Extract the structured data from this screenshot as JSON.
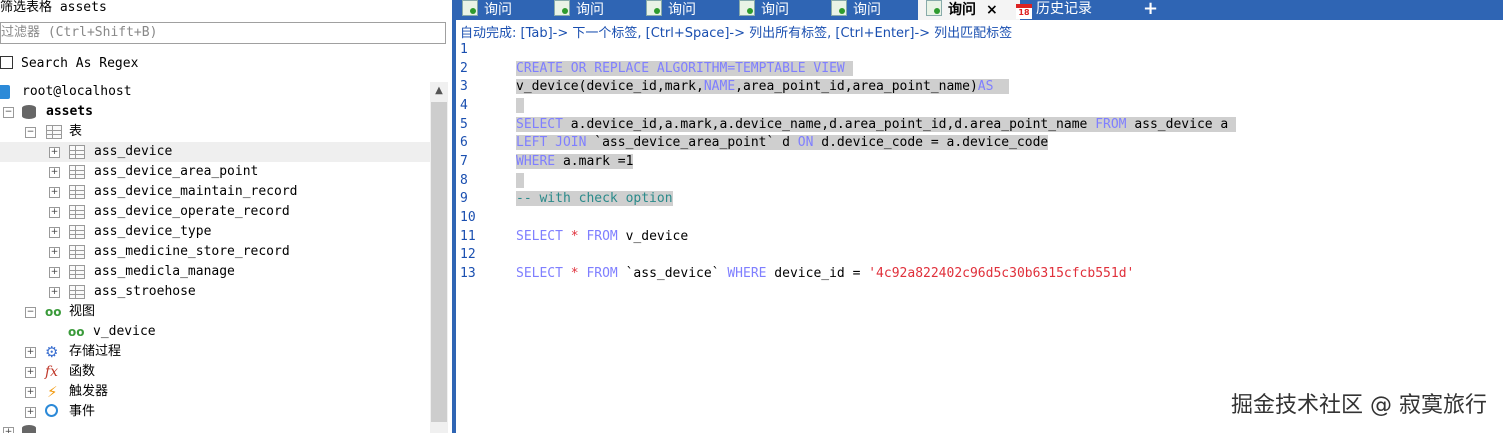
{
  "left": {
    "title": "筛选表格 assets",
    "filter_placeholder": "过滤器 (Ctrl+Shift+B)",
    "regex_label": "Search As Regex",
    "tree": {
      "connection": "root@localhost",
      "database": "assets",
      "tables_label": "表",
      "tables": [
        "ass_device",
        "ass_device_area_point",
        "ass_device_maintain_record",
        "ass_device_operate_record",
        "ass_device_type",
        "ass_medicine_store_record",
        "ass_medicla_manage",
        "ass_stroehose"
      ],
      "views_label": "视图",
      "views": [
        "v_device"
      ],
      "procedures_label": "存储过程",
      "functions_label": "函数",
      "triggers_label": "触发器",
      "events_label": "事件"
    }
  },
  "tabs": [
    {
      "label": "询问"
    },
    {
      "label": "询问"
    },
    {
      "label": "询问"
    },
    {
      "label": "询问"
    },
    {
      "label": "询问"
    },
    {
      "label": "询问",
      "active": true,
      "close": "×"
    },
    {
      "label": "历史记录",
      "calendar_day": "18"
    },
    {
      "label": "+"
    }
  ],
  "autocomplete_hint": "自动完成: [Tab]-> 下一个标签, [Ctrl+Space]-> 列出所有标签, [Ctrl+Enter]-> 列出匹配标签",
  "editor": {
    "line_numbers": [
      "1",
      "2",
      "3",
      "4",
      "5",
      "6",
      "7",
      "8",
      "9",
      "10",
      "11",
      "12",
      "13"
    ],
    "lines": [
      {
        "t1": ""
      },
      {
        "k1": "CREATE OR REPLACE ALGORITHM",
        "t1": "=",
        "k2": "TEMPTABLE VIEW",
        "t2": " "
      },
      {
        "t1": "v_device(device_id,mark,",
        "k1": "NAME",
        "t2": ",area_point_id,area_point_name)",
        "k2": "AS",
        "t3": "  "
      },
      {
        "t1": " "
      },
      {
        "k1": "SELECT",
        "t1": " a.device_id,a.mark,a.device_name,d.area_point_id,d.area_point_name ",
        "k2": "FROM",
        "t2": " ass_device a "
      },
      {
        "k1": "LEFT JOIN",
        "t1": " `ass_device_area_point` d ",
        "k2": "ON",
        "t2": " d.device_code = a.device_code"
      },
      {
        "k1": "WHERE",
        "t1": " a.mark =1"
      },
      {
        "t1": " "
      },
      {
        "c1": "-- with check option"
      },
      {
        "t1": ""
      },
      {
        "k1": "SELECT",
        "t1": " ",
        "k2": "*",
        "t2": " ",
        "k3": "FROM",
        "t3": " v_device"
      },
      {
        "t1": ""
      },
      {
        "k1": "SELECT",
        "t1": " ",
        "k2": "*",
        "t2": " ",
        "k3": "FROM",
        "t3": " `ass_device` ",
        "k4": "WHERE",
        "t4": " device_id = ",
        "s1": "'4c92a822402c96d5c30b6315cfcb551d'"
      }
    ]
  },
  "watermark": "掘金技术社区 @ 寂寞旅行"
}
